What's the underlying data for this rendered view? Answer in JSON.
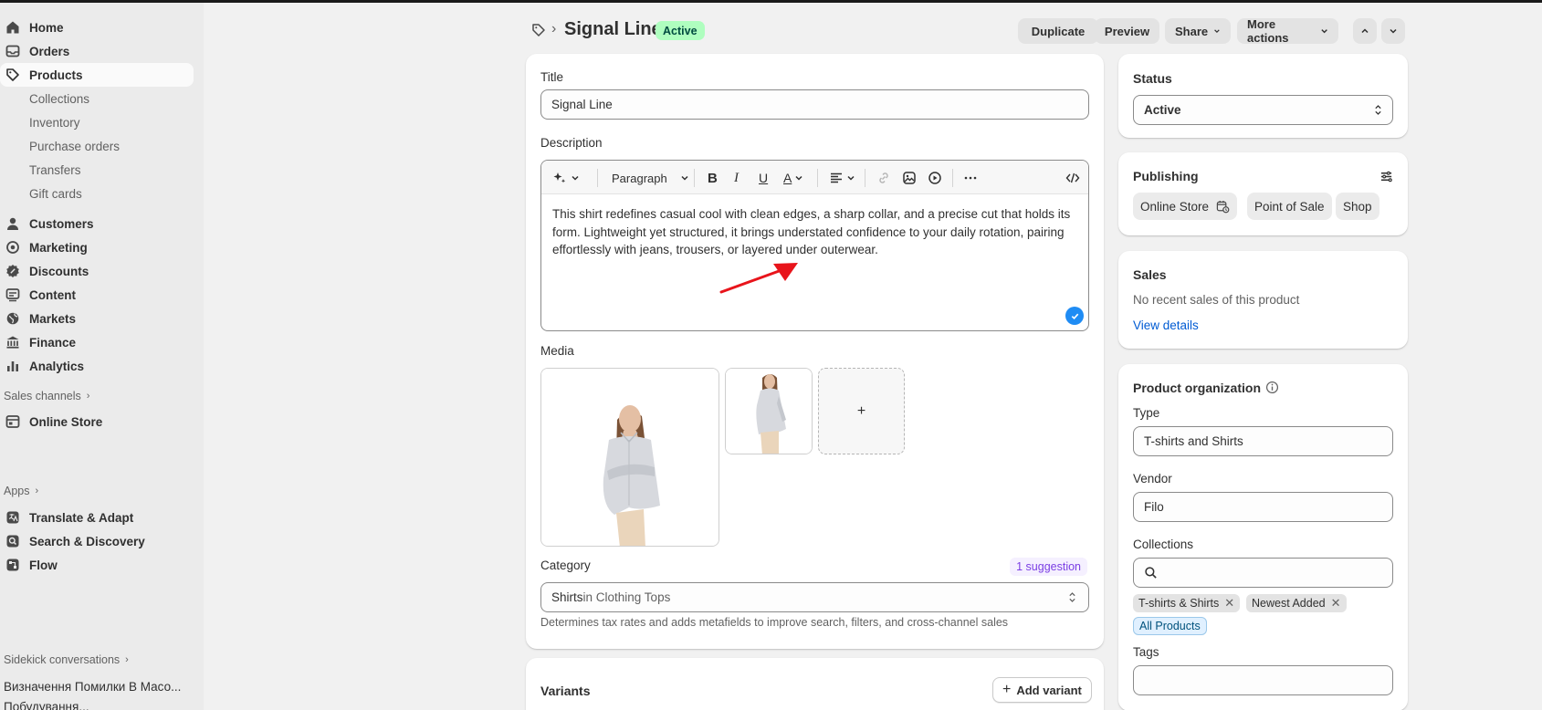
{
  "sidebar": {
    "main": [
      {
        "label": "Home",
        "icon": "home-icon"
      },
      {
        "label": "Orders",
        "icon": "orders-icon"
      },
      {
        "label": "Products",
        "icon": "tag-icon"
      }
    ],
    "products_sub": [
      "Collections",
      "Inventory",
      "Purchase orders",
      "Transfers",
      "Gift cards"
    ],
    "more": [
      {
        "label": "Customers",
        "icon": "person-icon"
      },
      {
        "label": "Marketing",
        "icon": "target-icon"
      },
      {
        "label": "Discounts",
        "icon": "discount-icon"
      },
      {
        "label": "Content",
        "icon": "content-icon"
      },
      {
        "label": "Markets",
        "icon": "globe-icon"
      },
      {
        "label": "Finance",
        "icon": "bank-icon"
      },
      {
        "label": "Analytics",
        "icon": "chart-icon"
      }
    ],
    "sales_channels_label": "Sales channels",
    "online_store": "Online Store",
    "apps_label": "Apps",
    "apps": [
      "Translate & Adapt",
      "Search & Discovery",
      "Flow"
    ],
    "sidekick_label": "Sidekick conversations",
    "sidekick_items": [
      "Визначення Помилки В Масо...",
      "Побудування..."
    ]
  },
  "header": {
    "title": "Signal Line",
    "status_badge": "Active",
    "duplicate": "Duplicate",
    "preview": "Preview",
    "share": "Share",
    "more_actions": "More actions"
  },
  "product": {
    "title_label": "Title",
    "title_value": "Signal Line",
    "description_label": "Description",
    "paragraph_select": "Paragraph",
    "description_text": "This shirt redefines casual cool with clean edges, a sharp collar, and a precise cut that holds its form. Lightweight yet structured, it brings understated confidence to your daily rotation, pairing effortlessly with jeans, trousers, or layered under outerwear.",
    "media_label": "Media",
    "add_media": "+",
    "category_label": "Category",
    "suggestion": "1 suggestion",
    "category_main": "Shirts",
    "category_in": " in Clothing Tops",
    "category_help": "Determines tax rates and adds metafields to improve search, filters, and cross-channel sales",
    "variants_label": "Variants",
    "add_variant": "Add variant"
  },
  "status_card": {
    "title": "Status",
    "value": "Active"
  },
  "publishing": {
    "title": "Publishing",
    "channels": [
      "Online Store",
      "Point of Sale",
      "Shop"
    ]
  },
  "sales": {
    "title": "Sales",
    "text": "No recent sales of this product",
    "link": "View details"
  },
  "organization": {
    "title": "Product organization",
    "type_label": "Type",
    "type_value": "T-shirts and Shirts",
    "vendor_label": "Vendor",
    "vendor_value": "Filo",
    "collections_label": "Collections",
    "collections": [
      "T-shirts & Shirts",
      "Newest Added"
    ],
    "suggested_collection": "All Products",
    "tags_label": "Tags"
  },
  "colors": {
    "accent": "#1f8cf4",
    "link": "#005bd3",
    "active_badge": "#affebf",
    "annotation_arrow": "#e8141b"
  }
}
